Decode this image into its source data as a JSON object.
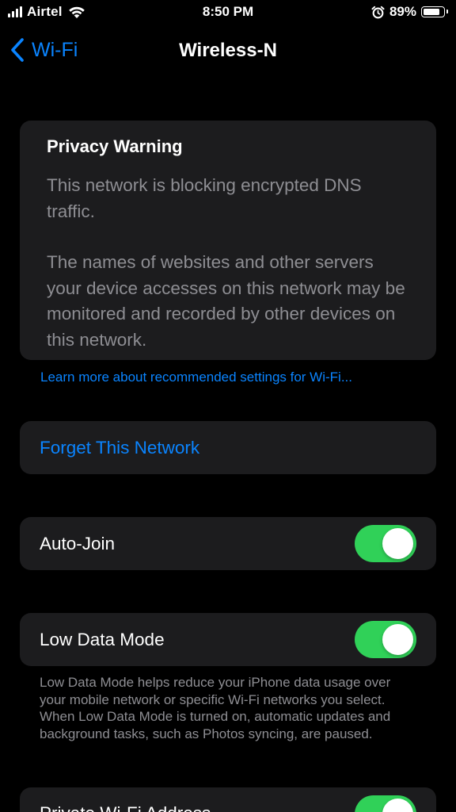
{
  "status_bar": {
    "carrier": "Airtel",
    "time": "8:50 PM",
    "battery_percent": "89%",
    "battery_level": 0.89,
    "icons": [
      "signal-icon",
      "wifi-icon",
      "alarm-icon",
      "battery-icon"
    ]
  },
  "nav": {
    "back_label": "Wi-Fi",
    "title": "Wireless-N"
  },
  "privacy_warning": {
    "title": "Privacy Warning",
    "paragraph_1": "This network is blocking encrypted DNS traffic.",
    "paragraph_2": "The names of websites and other servers your device accesses on this network may be monitored and recorded by other devices on this network."
  },
  "learn_more_link": "Learn more about recommended settings for Wi-Fi...",
  "forget_network": "Forget This Network",
  "settings": {
    "auto_join": {
      "label": "Auto-Join",
      "on": true
    },
    "low_data_mode": {
      "label": "Low Data Mode",
      "on": true,
      "footnote": "Low Data Mode helps reduce your iPhone data usage over your mobile network or specific Wi-Fi networks you select. When Low Data Mode is turned on, automatic updates and background tasks, such as Photos syncing, are paused."
    },
    "private_address": {
      "label": "Private Wi-Fi Address",
      "on": true
    }
  },
  "colors": {
    "accent": "#0a84ff",
    "toggle_on": "#30d158",
    "card_bg": "#1c1c1e",
    "secondary_text": "#8e8e93"
  }
}
